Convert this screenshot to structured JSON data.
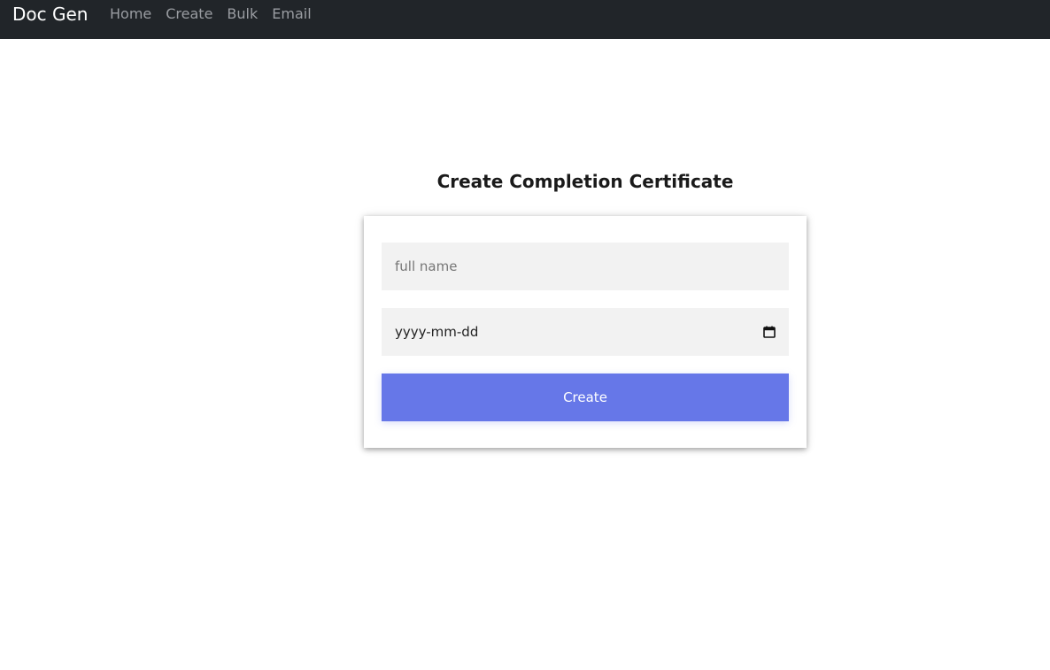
{
  "navbar": {
    "brand": "Doc Gen",
    "links": [
      {
        "label": "Home"
      },
      {
        "label": "Create"
      },
      {
        "label": "Bulk"
      },
      {
        "label": "Email"
      }
    ],
    "background": "#212529"
  },
  "main": {
    "title": "Create Completion Certificate",
    "form": {
      "name_placeholder": "full name",
      "date_placeholder": "yyyy-mm-dd",
      "submit_label": "Create",
      "accent_color": "#6677e8"
    }
  }
}
